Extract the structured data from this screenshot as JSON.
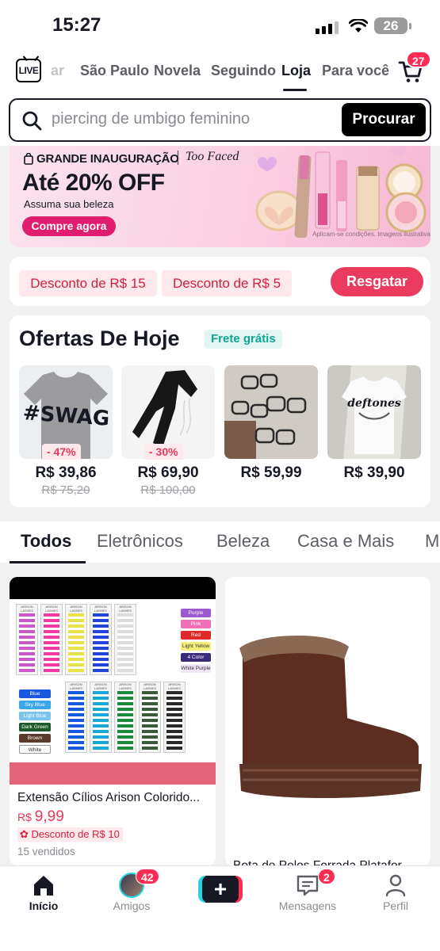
{
  "status_bar": {
    "time": "15:27",
    "battery": "26"
  },
  "top_nav": {
    "tabs": [
      "ar",
      "São Paulo",
      "Novela",
      "Seguindo",
      "Loja",
      "Para você"
    ],
    "live_label": "LIVE",
    "cart_badge": "27"
  },
  "search": {
    "value": "piercing de umbigo feminino",
    "button_label": "Procurar"
  },
  "banner": {
    "headline": "GRANDE INAUGURAÇÃO",
    "brand": "Too Faced",
    "title": "Até 20% OFF",
    "subtitle": "Assuma sua beleza",
    "cta": "Compre agora",
    "note": "Aplicam-se condições. Imagens ilustrativas"
  },
  "coupons": {
    "items": [
      "Desconto de R$ 15",
      "Desconto de R$ 5"
    ],
    "action": "Resgatar"
  },
  "offers": {
    "title": "Ofertas De Hoje",
    "badge": "Frete grátis",
    "products": [
      {
        "price": "R$ 39,86",
        "original": "R$ 75,20",
        "discount": "- 47%",
        "image": "gray-swag-tshirt"
      },
      {
        "price": "R$ 69,90",
        "original": "R$ 100,00",
        "discount": "- 30%",
        "image": "black-pants"
      },
      {
        "price": "R$ 59,99",
        "original": "",
        "discount": "",
        "image": "eyeglasses"
      },
      {
        "price": "R$ 39,90",
        "original": "",
        "discount": "",
        "image": "white-graphic-tshirt"
      }
    ]
  },
  "categories": [
    "Todos",
    "Eletrônicos",
    "Beleza",
    "Casa e Mais",
    "M"
  ],
  "feed": [
    {
      "title": "Extensão Cílios Arison Colorido...",
      "currency": "R$",
      "price": "9,99",
      "coupon": "Desconto de R$ 10",
      "sold": "15 vendidos",
      "image": "colored-eyelash-extensions",
      "swatches": [
        "Purple",
        "Pink",
        "Red",
        "Light Yellow",
        "4 Color",
        "White Purple"
      ],
      "swatches2": [
        "Blue",
        "Sky Blue",
        "Light Blue",
        "Dark Green",
        "Brown",
        "White"
      ],
      "brand_label": "ARISON LASHES"
    },
    {
      "title": "Bota de Pelos Forrada Platafor...",
      "image": "brown-fur-platform-boot"
    }
  ],
  "bottom_nav": {
    "items": [
      "Início",
      "Amigos",
      "",
      "Mensagens",
      "Perfil"
    ],
    "friends_badge": "42",
    "messages_badge": "2"
  },
  "colors": {
    "accent": "#fe2c55",
    "coupon_text": "#d4203f",
    "teal": "#11a594"
  }
}
